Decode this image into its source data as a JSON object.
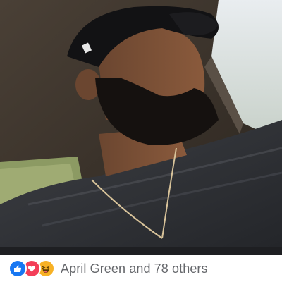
{
  "post": {
    "photo": {
      "subject": "man-in-car-selfie"
    },
    "reactions": {
      "icons": [
        "like-icon",
        "love-icon",
        "haha-icon"
      ],
      "colors": {
        "like": "#1877f2",
        "love": "#f33e58",
        "haha": "#f7b125"
      },
      "summary_text": "April Green and 78 others"
    }
  }
}
